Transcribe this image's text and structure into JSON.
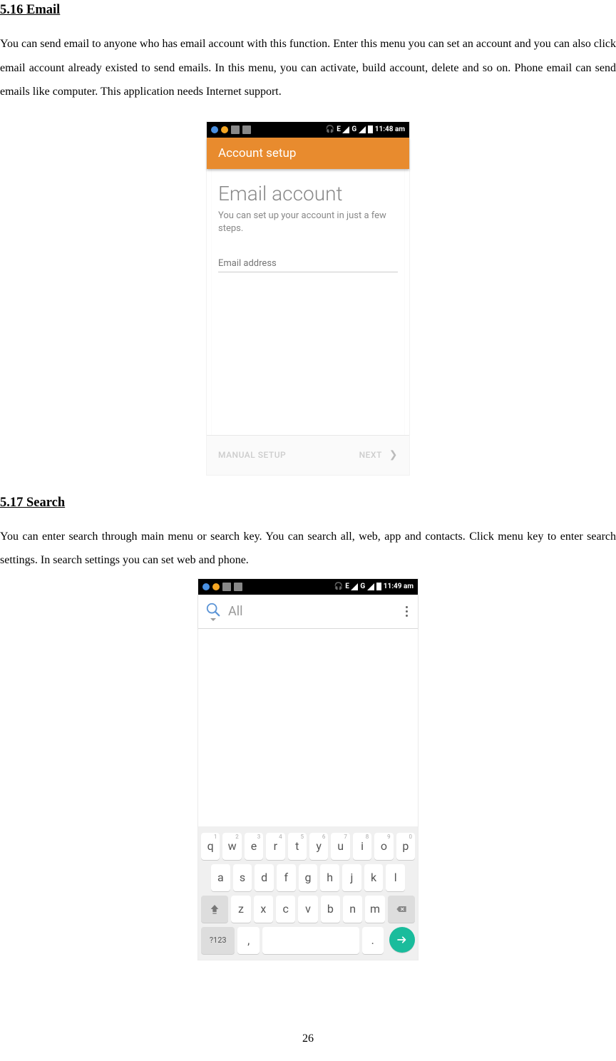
{
  "section1": {
    "heading": "5.16    Email",
    "body": "You can send email to anyone who has email account with this function. Enter this menu you can set an account and you can also click email account already existed to send emails. In this menu, you can activate, build account, delete and so on. Phone email can send emails like computer. This application needs Internet support."
  },
  "emailShot": {
    "statusTime": "11:48 am",
    "network1": "E",
    "network2": "G",
    "appBarTitle": "Account setup",
    "heading": "Email account",
    "sub": "You can set up your account in just a few steps.",
    "placeholder": "Email address",
    "manual": "MANUAL SETUP",
    "next": "NEXT"
  },
  "section2": {
    "heading": "5.17    Search",
    "body": "You can enter search through main menu or search key. You can search all, web, app and contacts. Click menu key to enter search settings. In search settings you can set web and phone."
  },
  "searchShot": {
    "statusTime": "11:49 am",
    "network1": "E",
    "network2": "G",
    "searchText": "All",
    "keyboard": {
      "row1": [
        "q",
        "w",
        "e",
        "r",
        "t",
        "y",
        "u",
        "i",
        "o",
        "p"
      ],
      "nums": [
        "1",
        "2",
        "3",
        "4",
        "5",
        "6",
        "7",
        "8",
        "9",
        "0"
      ],
      "row2": [
        "a",
        "s",
        "d",
        "f",
        "g",
        "h",
        "j",
        "k",
        "l"
      ],
      "row3": [
        "z",
        "x",
        "c",
        "v",
        "b",
        "n",
        "m"
      ],
      "row4_123": "?123",
      "row4_comma": ",",
      "row4_dot": "."
    }
  },
  "pageNumber": "26"
}
